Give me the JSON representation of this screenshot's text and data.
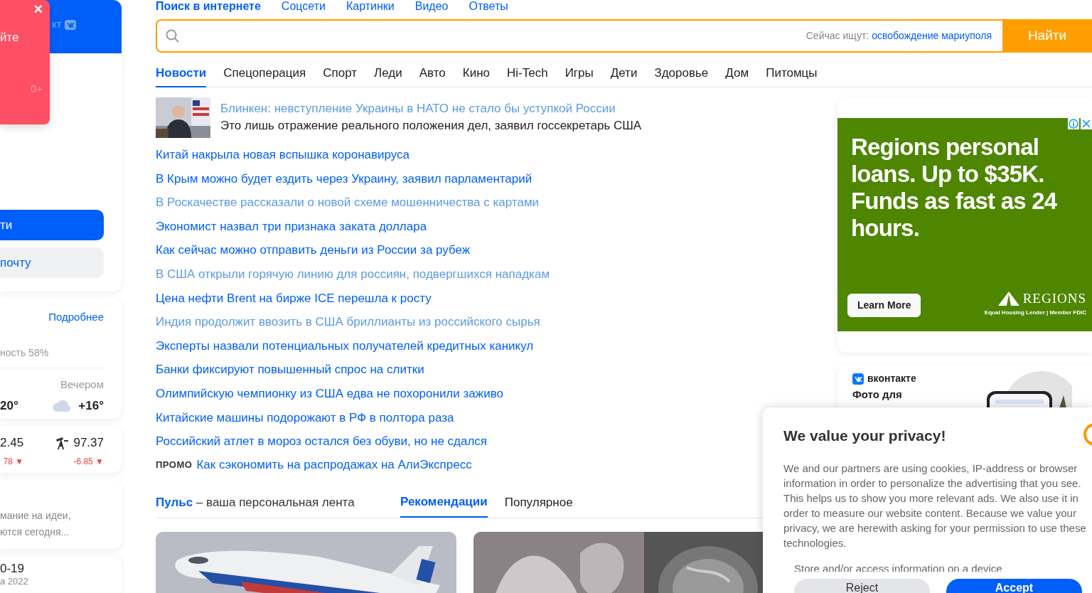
{
  "sidebar": {
    "popup": {
      "close": "×",
      "text": "йте",
      "age": "0+"
    },
    "login_header": {
      "text": "кт"
    },
    "buttons": [
      {
        "label": "ти",
        "kind": "primary"
      },
      {
        "label": "почту",
        "kind": "secondary"
      }
    ],
    "weather": {
      "link": "Подробнее",
      "humidity": "ность 58%",
      "evening_label": "Вечером",
      "temp_now": "20°",
      "temp_evening": "+16°"
    },
    "rates": [
      {
        "value": "2.45",
        "change": "78 ▼",
        "kind": "plain"
      },
      {
        "value": "97.37",
        "change": "-6.85 ▼",
        "kind": "oil"
      }
    ],
    "horoscope": {
      "lines": [
        "мание на идеи,",
        "ются сегодня..."
      ]
    },
    "covid": {
      "title": "0-19",
      "date": "а 2022"
    }
  },
  "search": {
    "tabs": [
      {
        "label": "Поиск в интернете",
        "selected": true
      },
      {
        "label": "Соцсети",
        "selected": false
      },
      {
        "label": "Картинки",
        "selected": false
      },
      {
        "label": "Видео",
        "selected": false
      },
      {
        "label": "Ответы",
        "selected": false
      }
    ],
    "trending_label": "Сейчас ищут:",
    "trending_query": "освобождение мариуполя",
    "button": "Найти"
  },
  "categories": [
    {
      "label": "Новости",
      "selected": true
    },
    {
      "label": "Спецоперация",
      "selected": false
    },
    {
      "label": "Спорт",
      "selected": false
    },
    {
      "label": "Леди",
      "selected": false
    },
    {
      "label": "Авто",
      "selected": false
    },
    {
      "label": "Кино",
      "selected": false
    },
    {
      "label": "Hi-Tech",
      "selected": false
    },
    {
      "label": "Игры",
      "selected": false
    },
    {
      "label": "Дети",
      "selected": false
    },
    {
      "label": "Здоровье",
      "selected": false
    },
    {
      "label": "Дом",
      "selected": false
    },
    {
      "label": "Питомцы",
      "selected": false
    }
  ],
  "news": {
    "lead": {
      "title": "Блинкен: невступление Украины в НАТО не стало бы уступкой России",
      "subtitle": "Это лишь отражение реального положения дел, заявил госсекретарь США",
      "visited": true
    },
    "items": [
      {
        "title": "Китай накрыла новая вспышка коронавируса",
        "visited": false
      },
      {
        "title": "В Крым можно будет ездить через Украину, заявил парламентарий",
        "visited": false
      },
      {
        "title": "В Роскачестве рассказали о новой схеме мошенничества с картами",
        "visited": true
      },
      {
        "title": "Экономист назвал три признака заката доллара",
        "visited": false
      },
      {
        "title": "Как сейчас можно отправить деньги из России за рубеж",
        "visited": false
      },
      {
        "title": "В США открыли горячую линию для россиян, подвергшихся нападкам",
        "visited": true
      },
      {
        "title": "Цена нефти Brent на бирже ICE перешла к росту",
        "visited": false
      },
      {
        "title": "Индия продолжит ввозить в США бриллианты из российского сырья",
        "visited": true
      },
      {
        "title": "Эксперты назвали потенциальных получателей кредитных каникул",
        "visited": false
      },
      {
        "title": "Банки фиксируют повышенный спрос на слитки",
        "visited": false
      },
      {
        "title": "Олимпийскую чемпионку из США едва не похоронили заживо",
        "visited": false
      },
      {
        "title": "Китайские машины подорожают в РФ в полтора раза",
        "visited": false
      },
      {
        "title": "Российский атлет в мороз остался без обуви, но не сдался",
        "visited": false
      }
    ],
    "promo": {
      "label": "ПРОМО",
      "title": "Как сэкономить на распродажах на АлиЭкспресс"
    }
  },
  "feed": {
    "pulse": {
      "name": "Пульс",
      "tagline": "– ваша персональная лента"
    },
    "tabs": [
      {
        "label": "Рекомендации",
        "selected": true
      },
      {
        "label": "Популярное",
        "selected": false
      }
    ]
  },
  "ad": {
    "headline": "Regions personal loans. Up to $35K. Funds as fast as 24 hours.",
    "button": "Learn More",
    "brand": "REGIONS",
    "disclaimer": "Equal Housing Lender | Member FDIC"
  },
  "vk_card": {
    "brand": "вконтакте",
    "title": "Фото для"
  },
  "privacy_dialog": {
    "title": "We value your privacy!",
    "text": "We and our partners are using cookies, IP-address or browser information in order to personalize the advertising that you see. This helps us to show you more relevant ads. We also use it in order to measure our website content. Because we value your privacy, we are herewith asking for your permission to use these technologies.",
    "purpose": "Store and/or access information on a device",
    "buttons": [
      {
        "label": "Reject",
        "kind": "secondary"
      },
      {
        "label": "Accept",
        "kind": "primary"
      }
    ]
  }
}
